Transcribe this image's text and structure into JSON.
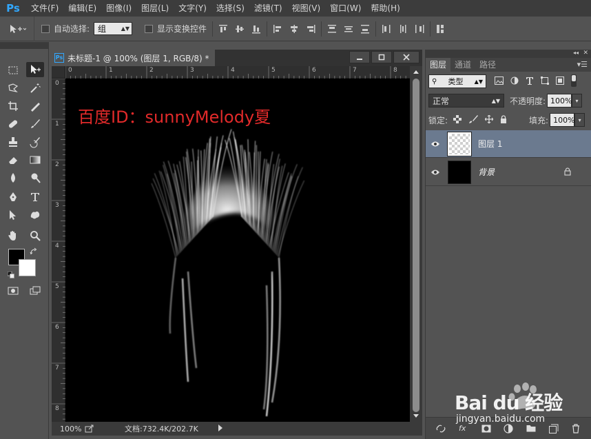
{
  "menubar": {
    "logo": "Ps",
    "items": [
      "文件(F)",
      "编辑(E)",
      "图像(I)",
      "图层(L)",
      "文字(Y)",
      "选择(S)",
      "滤镜(T)",
      "视图(V)",
      "窗口(W)",
      "帮助(H)"
    ]
  },
  "options": {
    "auto_select_label": "自动选择:",
    "auto_select_value": "组",
    "show_transform_label": "显示变换控件"
  },
  "document": {
    "tab_title": "未标题-1 @ 100% (图层 1, RGB/8) *",
    "canvas_text": "百度ID：sunnyMelody夏",
    "ruler_h": [
      "0",
      "1",
      "2",
      "3",
      "4",
      "5",
      "6",
      "7",
      "8"
    ],
    "ruler_v": [
      "0",
      "1",
      "2",
      "3",
      "4",
      "5",
      "6",
      "7",
      "8"
    ],
    "status_zoom": "100%",
    "status_doc": "文档:732.4K/202.7K"
  },
  "layers_panel": {
    "tabs": [
      "图层",
      "通道",
      "路径"
    ],
    "filter_type": "类型",
    "blend_mode": "正常",
    "opacity_label": "不透明度:",
    "opacity_value": "100%",
    "lock_label": "锁定:",
    "fill_label": "填充:",
    "fill_value": "100%",
    "layers": [
      {
        "name": "图层 1",
        "selected": true
      },
      {
        "name": "背景",
        "selected": false
      }
    ]
  },
  "watermark": {
    "brand": "Bai du 经验",
    "url": "jingyan.baidu.com"
  },
  "colors": {
    "accent_ps": "#31a8ff",
    "canvas_text": "#e12a2a",
    "selected_layer": "#6b7a8f"
  }
}
